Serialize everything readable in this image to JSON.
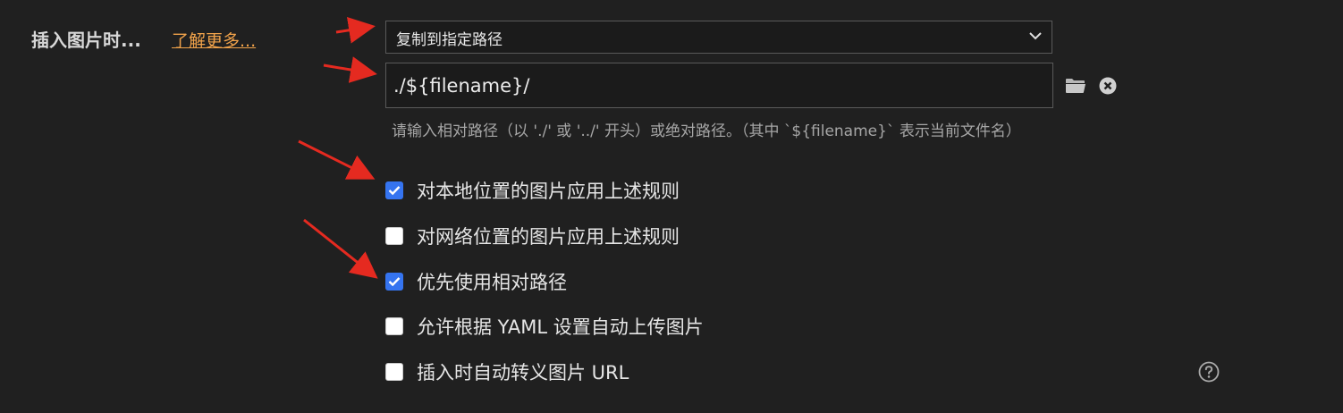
{
  "section": {
    "title": "插入图片时...",
    "learn_more": "了解更多..."
  },
  "dropdown": {
    "selected": "复制到指定路径"
  },
  "path": {
    "value": "./${filename}/",
    "hint": "请输入相对路径（以 './' 或 '../' 开头）或绝对路径。（其中 `${filename}` 表示当前文件名）"
  },
  "options": [
    {
      "label": "对本地位置的图片应用上述规则",
      "checked": true
    },
    {
      "label": "对网络位置的图片应用上述规则",
      "checked": false
    },
    {
      "label": "优先使用相对路径",
      "checked": true
    },
    {
      "label": "允许根据 YAML 设置自动上传图片",
      "checked": false
    },
    {
      "label": "插入时自动转义图片 URL",
      "checked": false
    }
  ],
  "icons": {
    "dropdown": "chevron-down-icon",
    "folder": "folder-icon",
    "clear": "clear-icon",
    "help": "help-icon"
  },
  "colors": {
    "background": "#202020",
    "accent": "#3574f0",
    "link": "#f0a24a",
    "annotation": "#e52a20"
  }
}
